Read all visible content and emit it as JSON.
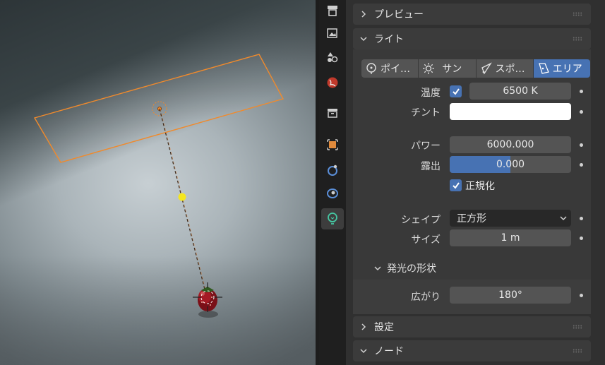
{
  "properties": {
    "preview_panel": {
      "title": "プレビュー"
    },
    "light_panel": {
      "title": "ライト",
      "light_types": [
        {
          "label": "ポイ…",
          "icon": "point-light-icon",
          "active": false
        },
        {
          "label": "サン",
          "icon": "sun-light-icon",
          "active": false
        },
        {
          "label": "スポ…",
          "icon": "spot-light-icon",
          "active": false
        },
        {
          "label": "エリア",
          "icon": "area-light-icon",
          "active": true
        }
      ],
      "temperature": {
        "label": "温度",
        "checked": true,
        "value": "6500 K"
      },
      "tint": {
        "label": "チント",
        "color": "#ffffff"
      },
      "power": {
        "label": "パワー",
        "value": "6000.000"
      },
      "exposure": {
        "label": "露出",
        "value": "0.000",
        "fill": 0.5
      },
      "normalize": {
        "label": "正規化",
        "checked": true
      },
      "shape": {
        "label": "シェイプ",
        "value": "正方形"
      },
      "size": {
        "label": "サイズ",
        "value": "1 m"
      },
      "beam_shape": {
        "title": "発光の形状",
        "spread": {
          "label": "広がり",
          "value": "180°"
        }
      }
    },
    "settings_panel": {
      "title": "設定"
    },
    "nodes_panel": {
      "title": "ノード"
    }
  },
  "tabs": [
    {
      "icon": "render-tool-icon",
      "active": false
    },
    {
      "icon": "output-image-icon",
      "active": false
    },
    {
      "icon": "view-layer-icon",
      "active": false
    },
    {
      "icon": "world-icon",
      "active": false
    },
    {
      "icon": "collection-box-icon",
      "active": false
    },
    {
      "icon": "object-icon",
      "active": false
    },
    {
      "icon": "physics-icon",
      "active": false
    },
    {
      "icon": "constraints-icon",
      "active": false
    },
    {
      "icon": "light-data-icon",
      "active": true
    }
  ],
  "colors": {
    "accent": "#4772b3",
    "selection_outline": "#f08a2c",
    "light_handle": "#f5e61e"
  }
}
